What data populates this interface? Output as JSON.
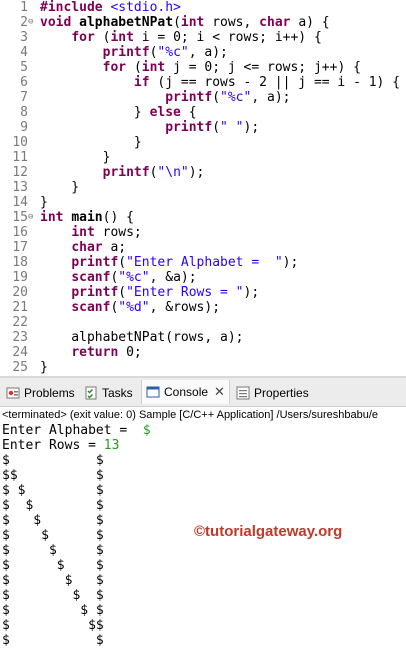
{
  "editor": {
    "line_numbers": [
      "1",
      "2",
      "3",
      "4",
      "5",
      "6",
      "7",
      "8",
      "9",
      "10",
      "11",
      "12",
      "13",
      "14",
      "15",
      "16",
      "17",
      "18",
      "19",
      "20",
      "21",
      "22",
      "23",
      "24",
      "25"
    ],
    "lines": [
      [
        {
          "t": "#include ",
          "c": "kw"
        },
        {
          "t": "<stdio.h>",
          "c": "str"
        }
      ],
      [
        {
          "t": "void ",
          "c": "kw"
        },
        {
          "t": "alphabetNPat",
          "c": "fn"
        },
        {
          "t": "(",
          "c": ""
        },
        {
          "t": "int ",
          "c": "kw"
        },
        {
          "t": "rows, ",
          "c": ""
        },
        {
          "t": "char ",
          "c": "kw"
        },
        {
          "t": "a) {",
          "c": ""
        }
      ],
      [
        {
          "t": "    ",
          "c": ""
        },
        {
          "t": "for ",
          "c": "kw"
        },
        {
          "t": "(",
          "c": ""
        },
        {
          "t": "int ",
          "c": "kw"
        },
        {
          "t": "i = 0; i < rows; i++) {",
          "c": ""
        }
      ],
      [
        {
          "t": "        ",
          "c": ""
        },
        {
          "t": "printf",
          "c": "kw"
        },
        {
          "t": "(",
          "c": ""
        },
        {
          "t": "\"%c\"",
          "c": "str"
        },
        {
          "t": ", a);",
          "c": ""
        }
      ],
      [
        {
          "t": "        ",
          "c": ""
        },
        {
          "t": "for ",
          "c": "kw"
        },
        {
          "t": "(",
          "c": ""
        },
        {
          "t": "int ",
          "c": "kw"
        },
        {
          "t": "j = 0; j <= rows; j++) {",
          "c": ""
        }
      ],
      [
        {
          "t": "            ",
          "c": ""
        },
        {
          "t": "if ",
          "c": "kw"
        },
        {
          "t": "(j == rows - 2 || j == i - 1) {",
          "c": ""
        }
      ],
      [
        {
          "t": "                ",
          "c": ""
        },
        {
          "t": "printf",
          "c": "kw"
        },
        {
          "t": "(",
          "c": ""
        },
        {
          "t": "\"%c\"",
          "c": "str"
        },
        {
          "t": ", a);",
          "c": ""
        }
      ],
      [
        {
          "t": "            } ",
          "c": ""
        },
        {
          "t": "else ",
          "c": "kw"
        },
        {
          "t": "{",
          "c": ""
        }
      ],
      [
        {
          "t": "                ",
          "c": ""
        },
        {
          "t": "printf",
          "c": "kw"
        },
        {
          "t": "(",
          "c": ""
        },
        {
          "t": "\" \"",
          "c": "str"
        },
        {
          "t": ");",
          "c": ""
        }
      ],
      [
        {
          "t": "            }",
          "c": ""
        }
      ],
      [
        {
          "t": "        }",
          "c": ""
        }
      ],
      [
        {
          "t": "        ",
          "c": ""
        },
        {
          "t": "printf",
          "c": "kw"
        },
        {
          "t": "(",
          "c": ""
        },
        {
          "t": "\"\\n\"",
          "c": "str"
        },
        {
          "t": ");",
          "c": ""
        }
      ],
      [
        {
          "t": "    }",
          "c": ""
        }
      ],
      [
        {
          "t": "}",
          "c": ""
        }
      ],
      [
        {
          "t": "int ",
          "c": "kw"
        },
        {
          "t": "main",
          "c": "fn"
        },
        {
          "t": "() {",
          "c": ""
        }
      ],
      [
        {
          "t": "    ",
          "c": ""
        },
        {
          "t": "int ",
          "c": "kw"
        },
        {
          "t": "rows;",
          "c": ""
        }
      ],
      [
        {
          "t": "    ",
          "c": ""
        },
        {
          "t": "char ",
          "c": "kw"
        },
        {
          "t": "a;",
          "c": ""
        }
      ],
      [
        {
          "t": "    ",
          "c": ""
        },
        {
          "t": "printf",
          "c": "kw"
        },
        {
          "t": "(",
          "c": ""
        },
        {
          "t": "\"Enter Alphabet =  \"",
          "c": "str"
        },
        {
          "t": ");",
          "c": ""
        }
      ],
      [
        {
          "t": "    ",
          "c": ""
        },
        {
          "t": "scanf",
          "c": "kw"
        },
        {
          "t": "(",
          "c": ""
        },
        {
          "t": "\"%c\"",
          "c": "str"
        },
        {
          "t": ", &a);",
          "c": ""
        }
      ],
      [
        {
          "t": "    ",
          "c": ""
        },
        {
          "t": "printf",
          "c": "kw"
        },
        {
          "t": "(",
          "c": ""
        },
        {
          "t": "\"Enter Rows = \"",
          "c": "str"
        },
        {
          "t": ");",
          "c": ""
        }
      ],
      [
        {
          "t": "    ",
          "c": ""
        },
        {
          "t": "scanf",
          "c": "kw"
        },
        {
          "t": "(",
          "c": ""
        },
        {
          "t": "\"%d\"",
          "c": "str"
        },
        {
          "t": ", &rows);",
          "c": ""
        }
      ],
      [
        {
          "t": "",
          "c": ""
        }
      ],
      [
        {
          "t": "    alphabetNPat(rows, a);",
          "c": ""
        }
      ],
      [
        {
          "t": "    ",
          "c": ""
        },
        {
          "t": "return ",
          "c": "kw"
        },
        {
          "t": "0;",
          "c": ""
        }
      ],
      [
        {
          "t": "}",
          "c": ""
        }
      ]
    ],
    "fold_markers": {
      "2": "⊖",
      "15": "⊖"
    }
  },
  "tabs": [
    {
      "label": "Problems",
      "icon": "problems-icon",
      "active": false
    },
    {
      "label": "Tasks",
      "icon": "tasks-icon",
      "active": false
    },
    {
      "label": "Console",
      "icon": "console-icon",
      "active": true
    },
    {
      "label": "Properties",
      "icon": "properties-icon",
      "active": false
    }
  ],
  "close_glyph": "✕",
  "status": "<terminated> (exit value: 0) Sample [C/C++ Application] /Users/sureshbabu/e",
  "console": {
    "prompt_alpha": "Enter Alphabet =  ",
    "alpha_input": "$",
    "prompt_rows": "Enter Rows = ",
    "rows_input": "13",
    "output_lines": [
      "$           $",
      "$$          $",
      "$ $         $",
      "$  $        $",
      "$   $       $",
      "$    $      $",
      "$     $     $",
      "$      $    $",
      "$       $   $",
      "$        $  $",
      "$         $ $",
      "$          $$",
      "$           $"
    ]
  },
  "watermark": "©tutorialgateway.org",
  "colors": {
    "keyword": "#7f0055",
    "string": "#2a00ff",
    "input": "#21a021",
    "watermark": "#c0392b"
  }
}
